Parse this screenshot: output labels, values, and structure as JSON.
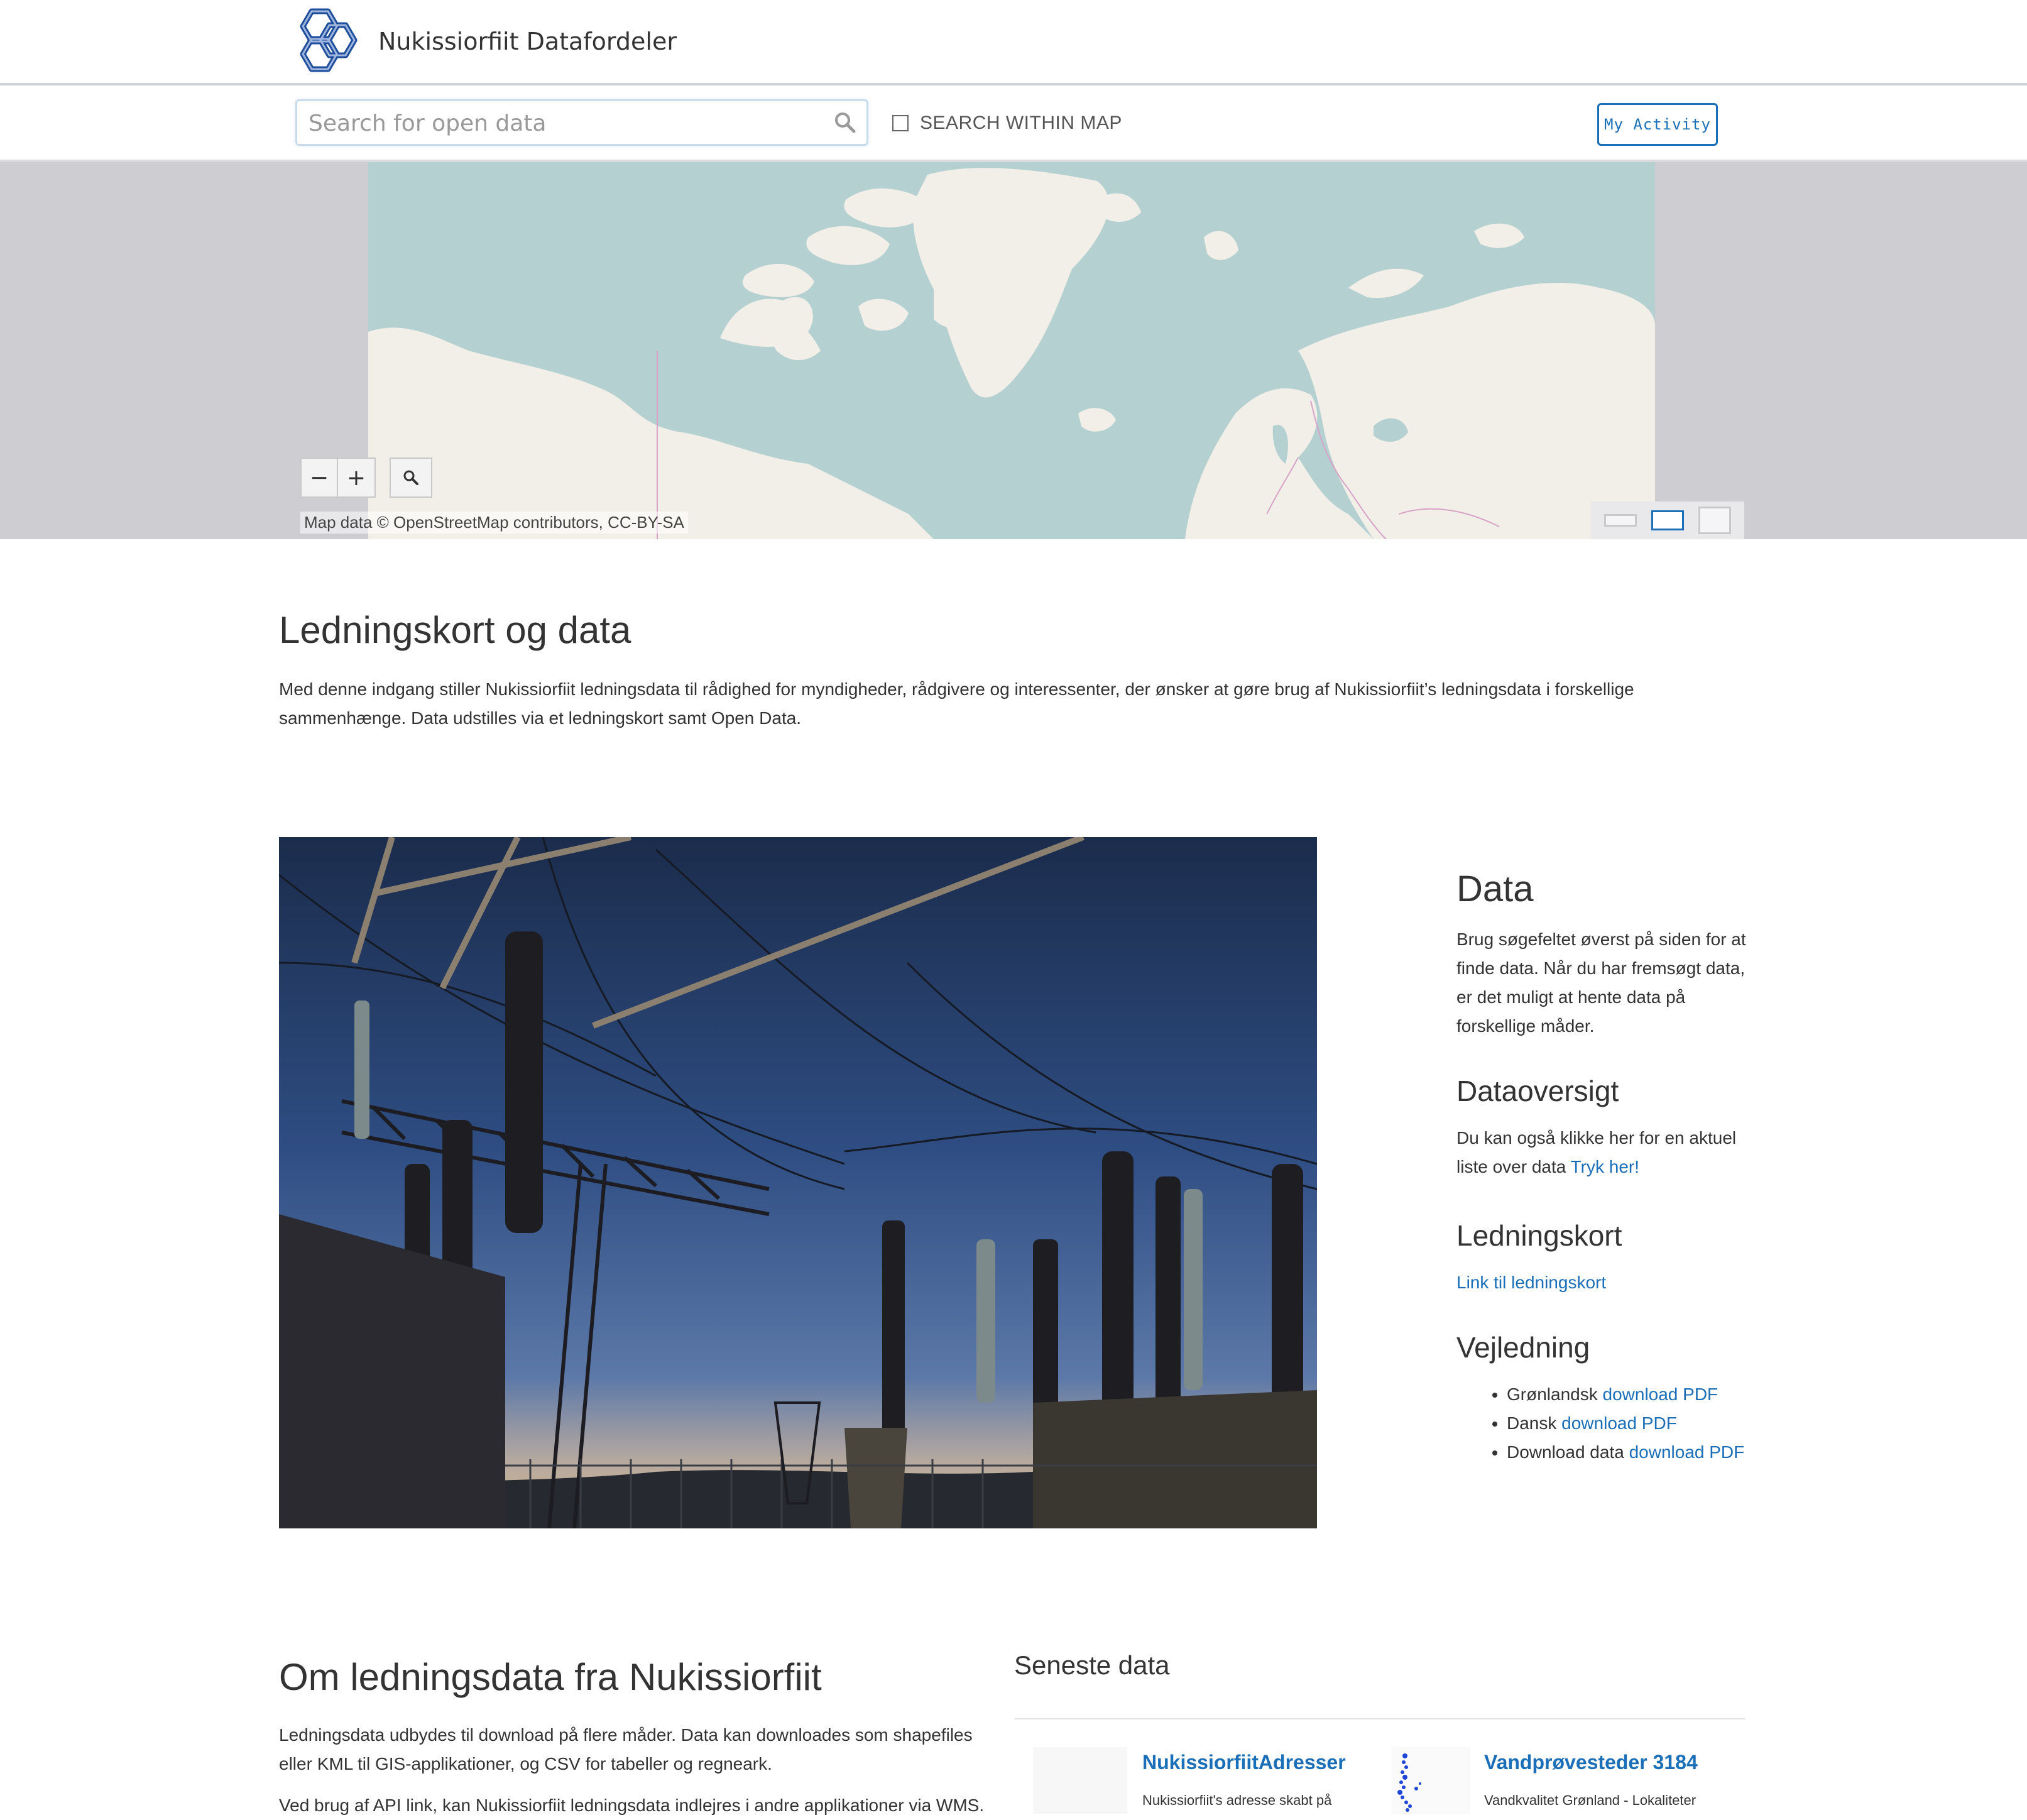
{
  "header": {
    "brand": "Nukissiorfiit Datafordeler",
    "logo_icon": "nukissiorfiit-logo-icon"
  },
  "search": {
    "placeholder": "Search for open data",
    "value": "",
    "within_map_label": "SEARCH WITHIN MAP",
    "within_map_checked": false,
    "my_activity_label": "My Activity"
  },
  "map": {
    "zoom_out_label": "−",
    "zoom_in_label": "+",
    "attribution": "Map data © OpenStreetMap contributors, CC-BY-SA",
    "layout_options": [
      "small-map",
      "medium-map",
      "large-map"
    ],
    "layout_selected": "medium-map"
  },
  "intro": {
    "title": "Ledningskort og data",
    "text": "Med denne indgang stiller Nukissiorfiit ledningsdata til rådighed for myndigheder, rådgivere og interessenter, der ønsker at gøre brug af Nukissiorfiit’s ledningsdata i forskellige sammenhænge. Data udstilles via et ledningskort samt Open Data."
  },
  "sidebar": {
    "data_heading": "Data",
    "data_text": "Brug søgefeltet øverst på siden for at finde data. Når du har fremsøgt data, er det muligt at hente data på forskellige måder.",
    "overview_heading": "Dataoversigt",
    "overview_text": "Du kan også klikke her for en aktuel liste over data",
    "overview_link": "Tryk her!",
    "map_heading": "Ledningskort",
    "map_link": "Link til ledningskort",
    "guide_heading": "Vejledning",
    "guides": [
      {
        "label": "Grønlandsk",
        "link": "download PDF"
      },
      {
        "label": "Dansk",
        "link": "download PDF"
      },
      {
        "label": "Download data",
        "link": "download PDF"
      }
    ]
  },
  "about": {
    "title": "Om ledningsdata fra Nukissiorfiit",
    "p1": "Ledningsdata udbydes til download på flere måder. Data kan downloades som shapefiles eller KML til GIS-applikationer, og CSV for tabeller og regneark.",
    "p2": "Ved brug af API link, kan Nukissiorfiit ledningsdata indlejres i andre applikationer via WMS."
  },
  "latest": {
    "heading": "Seneste data",
    "items": [
      {
        "title": "NukissiorfiitAdresser",
        "desc": "Nukissiorfiit's adresse skabt på"
      },
      {
        "title": "Vandprøvesteder 3184",
        "desc": "Vandkvalitet Grønland - Lokaliteter"
      }
    ]
  },
  "colors": {
    "accent": "#1a6fb8",
    "map_water": "#b5d0d0",
    "map_land": "#f2efe9",
    "map_border": "#d7a3c8"
  }
}
